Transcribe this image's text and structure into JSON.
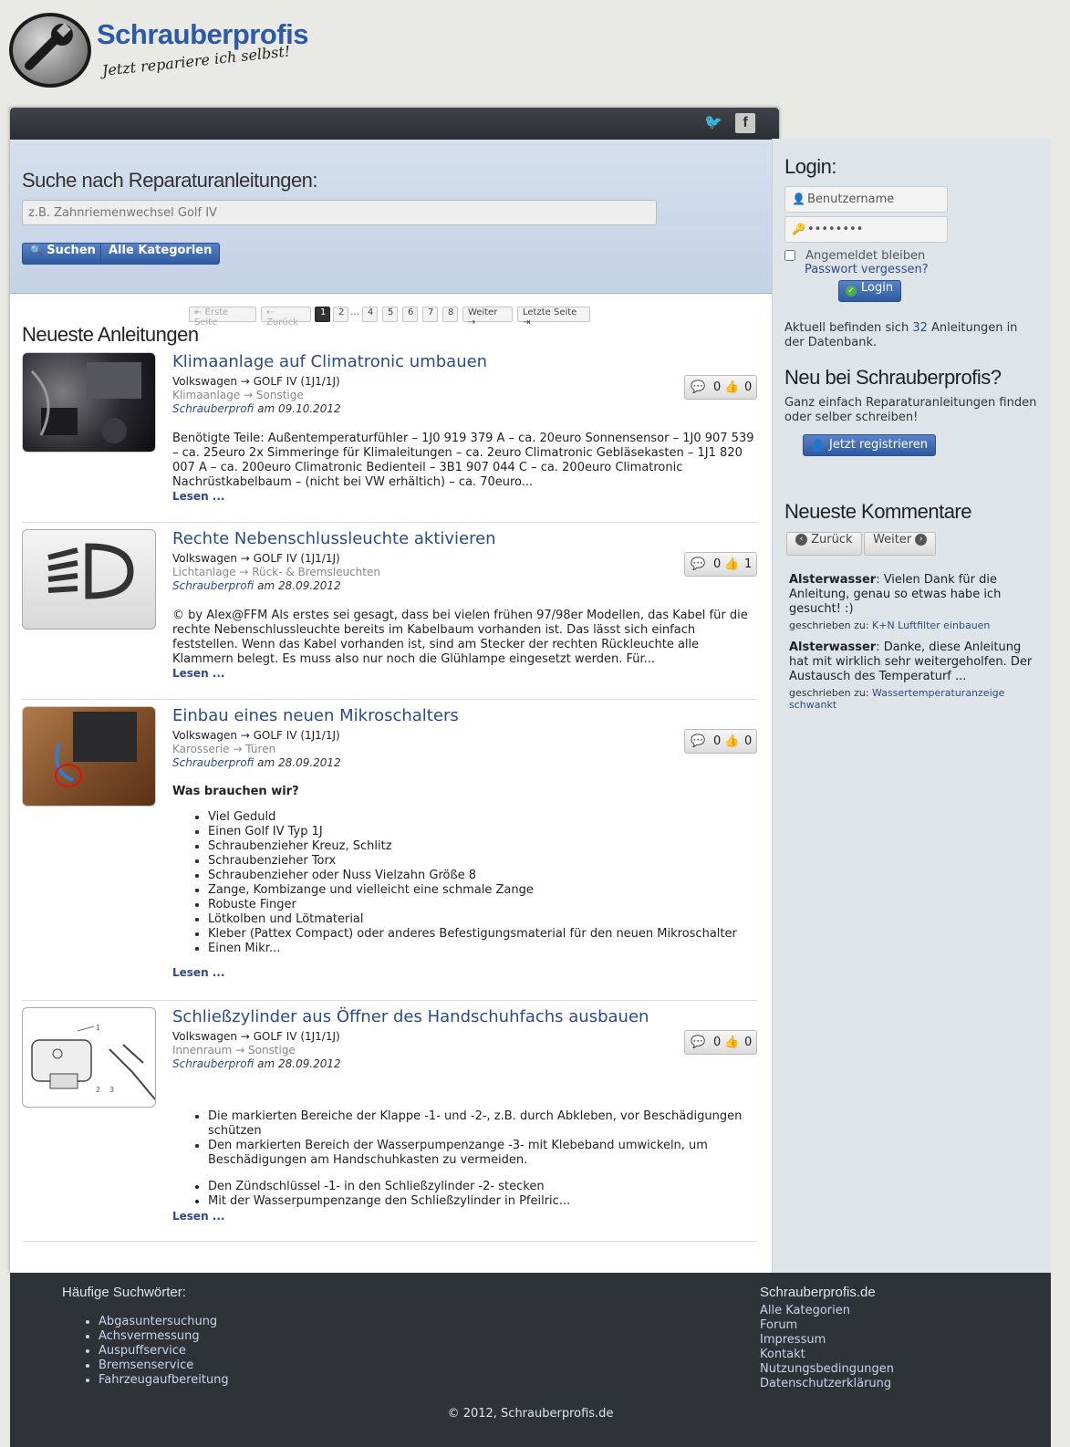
{
  "header": {
    "site_title": "Schrauberprofis",
    "slogan": "Jetzt repariere ich selbst!"
  },
  "search": {
    "heading": "Suche nach Reparaturanleitungen:",
    "placeholder": "z.B. Zahnriemenwechsel Golf IV",
    "search_button": "Suchen",
    "categories_button": "Alle Kategorien"
  },
  "pagination": {
    "first": "⇤ Erste Seite",
    "prev": "⇠ Zurück",
    "pages": [
      "1",
      "2",
      "4",
      "5",
      "6",
      "7",
      "8"
    ],
    "current": "1",
    "dots": "…",
    "next": "Weiter ⇢",
    "last": "Letzte Seite ⇥"
  },
  "main": {
    "section_title": "Neueste Anleitungen",
    "read_more": "Lesen ...",
    "articles": [
      {
        "title": "Klimaanlage auf Climatronic umbauen",
        "make": "Volkswagen → GOLF IV (1J1/1J)",
        "category": "Klimaanlage → Sonstige",
        "author": "Schrauberprofi",
        "date": "am 09.10.2012",
        "comments": "0",
        "likes": "0",
        "excerpt": "Benötigte Teile: Außentemperaturfühler – 1J0 919 379 A – ca. 20euro Sonnensensor – 1J0 907 539 – ca. 25euro 2x Simmeringe für Klimaleitungen – ca. 2euro Climatronic Gebläsekasten – 1J1 820 007 A – ca. 200euro Climatronic Bedienteil – 3B1 907 044 C – ca. 200euro Climatronic Nachrüstkabelbaum – (nicht bei VW erhältich) – ca. 70euro..."
      },
      {
        "title": "Rechte Nebenschlussleuchte aktivieren",
        "make": "Volkswagen → GOLF IV (1J1/1J)",
        "category": "Lichtanlage → Rück- & Bremsleuchten",
        "author": "Schrauberprofi",
        "date": "am 28.09.2012",
        "comments": "0",
        "likes": "1",
        "excerpt": "© by Alex@FFM Als erstes sei gesagt, dass bei vielen frühen 97/98er Modellen, das Kabel für die rechte Nebenschlussleuchte bereits im Kabelbaum vorhanden ist. Das lässt sich einfach feststellen. Wenn das Kabel vorhanden ist, sind am Stecker der rechten Rückleuchte alle Klammern belegt. Es muss also nur noch die Glühlampe eingesetzt werden. Für..."
      },
      {
        "title": "Einbau eines neuen Mikroschalters",
        "make": "Volkswagen → GOLF IV (1J1/1J)",
        "category": "Karosserie → Türen",
        "author": "Schrauberprofi",
        "date": "am 28.09.2012",
        "comments": "0",
        "likes": "0",
        "intro": "Was brauchen wir?",
        "items": [
          "Viel Geduld",
          "Einen Golf IV Typ 1J",
          "Schraubenzieher Kreuz, Schlitz",
          "Schraubenzieher Torx",
          "Schraubenzieher oder Nuss Vielzahn Größe 8",
          "Zange, Kombizange und vielleicht eine schmale Zange",
          "Robuste Finger",
          "Lötkolben und Lötmaterial",
          "Kleber (Pattex Compact) oder anderes Befestigungsmaterial für den neuen Mikroschalter",
          "Einen Mikr..."
        ]
      },
      {
        "title": "Schließzylinder aus Öffner des Handschuhfachs ausbauen",
        "make": "Volkswagen → GOLF IV (1J1/1J)",
        "category": "Innenraum → Sonstige",
        "author": "Schrauberprofi",
        "date": "am 28.09.2012",
        "comments": "0",
        "likes": "0",
        "items_a": [
          "Die markierten Bereiche der Klappe -1- und -2-, z.B. durch Abkleben, vor Beschädigungen schützen",
          "Den markierten Bereich der Wasserpumpenzange -3- mit Klebeband umwickeln, um Beschädigungen am Handschuhkasten zu vermeiden."
        ],
        "items_b": [
          "Den Zündschlüssel -1- in den Schließzylinder -2- stecken",
          "Mit der Wasserpumpenzange den Schließzylinder in Pfeilric..."
        ],
        "diagram_labels": [
          "1",
          "2",
          "3"
        ]
      }
    ]
  },
  "sidebar": {
    "login_heading": "Login:",
    "username_placeholder": "Benutzername",
    "password_value": "••••••••",
    "remember_label": "Angemeldet bleiben",
    "forgot_link": "Passwort vergessen?",
    "login_button": "Login",
    "count_prefix": "Aktuell befinden sich",
    "count_value": "32",
    "count_suffix": "Anleitungen in der Datenbank.",
    "new_heading": "Neu bei Schrauberprofis?",
    "new_text": "Ganz einfach Reparaturanleitungen finden oder selber schreiben!",
    "register_button": "Jetzt registrieren",
    "comments_heading": "Neueste Kommentare",
    "prev_button": "Zurück",
    "next_button": "Weiter",
    "written_for": "geschrieben zu:",
    "comments": [
      {
        "author": "Alsterwasser",
        "text": ": Vielen Dank für die Anleitung, genau so etwas habe ich gesucht! :)",
        "article": "K+N Luftfilter einbauen"
      },
      {
        "author": "Alsterwasser",
        "text": ": Danke, diese Anleitung hat mit wirklich sehr weitergeholfen. Der Austausch des Temperaturf ...",
        "article": "Wassertemperaturanzeige schwankt"
      }
    ]
  },
  "footer": {
    "keywords_heading": "Häufige Suchwörter:",
    "keywords": [
      "Abgasuntersuchung",
      "Achsvermessung",
      "Auspuffservice",
      "Bremsenservice",
      "Fahrzeugaufbereitung"
    ],
    "site_heading": "Schrauberprofis.de",
    "links": [
      "Alle Kategorien",
      "Forum",
      "Impressum",
      "Kontakt",
      "Nutzungsbedingungen",
      "Datenschutzerklärung"
    ],
    "copyright": "© 2012, Schrauberprofis.de"
  },
  "colors": {
    "accent": "#2b4a8b",
    "button": "#2f5aa0",
    "footer_bg": "#2f3237",
    "sidebar_bg": "#dfe4e9"
  }
}
